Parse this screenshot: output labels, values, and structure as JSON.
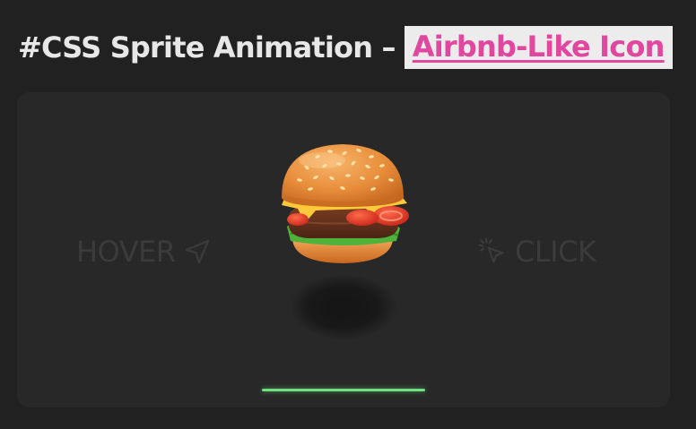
{
  "header": {
    "title_prefix": "#CSS Sprite Animation –",
    "title_link": "Airbnb-Like Icon"
  },
  "demo": {
    "hover_label": "HOVER",
    "click_label": "CLICK",
    "hover_icon": "send-arrow-icon",
    "click_icon": "pointer-click-icon",
    "sprite": "burger",
    "progress": 1.0,
    "colors": {
      "background": "#212121",
      "card": "#282828",
      "link": "#e0479e",
      "link_background": "#ececec",
      "progress": "#6fe07e"
    }
  }
}
